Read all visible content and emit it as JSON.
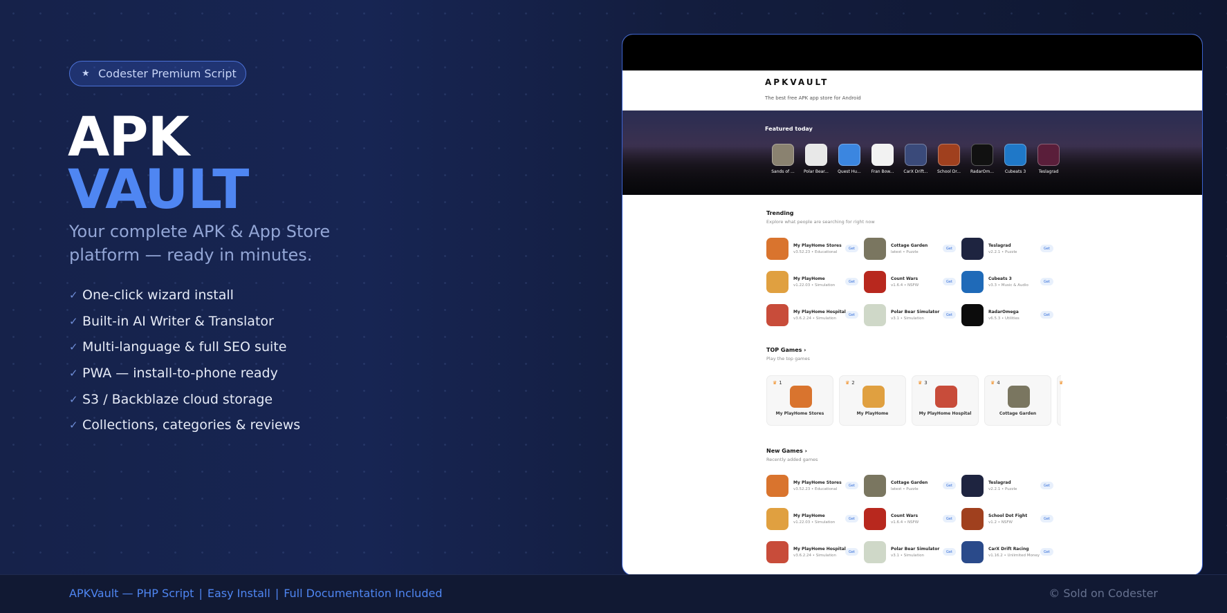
{
  "badge": {
    "icon": "star-icon",
    "label": "Codester Premium Script"
  },
  "title": {
    "line1": "APK",
    "line2": "VAULT"
  },
  "subtitle": "Your complete APK & App Store platform — ready in minutes.",
  "features": [
    {
      "icon": "check-icon",
      "label": "One-click wizard install"
    },
    {
      "icon": "check-icon",
      "label": "Built-in AI Writer & Translator"
    },
    {
      "icon": "check-icon",
      "label": "Multi-language & full SEO suite"
    },
    {
      "icon": "check-icon",
      "label": "PWA — install-to-phone ready"
    },
    {
      "icon": "check-icon",
      "label": "S3 / Backblaze cloud storage"
    },
    {
      "icon": "check-icon",
      "label": "Collections, categories & reviews"
    }
  ],
  "footer": {
    "left": [
      "APKVault — PHP Script",
      "Easy Install",
      "Full Documentation Included"
    ],
    "separator": "|",
    "right": "© Sold on Codester"
  },
  "colors": {
    "accent": "#4f86f2",
    "background": "#131c38"
  },
  "preview": {
    "brand": "APKVAULT",
    "tagline": "The best free APK app store for Android",
    "featured": {
      "title": "Featured today",
      "apps": [
        {
          "label": "Sands of ...",
          "color": "#8a8270"
        },
        {
          "label": "Polar Bear...",
          "color": "#e8e8e8"
        },
        {
          "label": "Quest Hu...",
          "color": "#3b86e0"
        },
        {
          "label": "Fran Bow...",
          "color": "#f2f2f2"
        },
        {
          "label": "CarX Drift...",
          "color": "#3a4a7a"
        },
        {
          "label": "School Dr...",
          "color": "#a0401e"
        },
        {
          "label": "RadarOm...",
          "color": "#111111"
        },
        {
          "label": "Cubeats 3",
          "color": "#1f78c8"
        },
        {
          "label": "Teslagrad",
          "color": "#5a1e3a"
        }
      ]
    },
    "trending": {
      "title": "Trending",
      "subtitle": "Explore what people are searching for right now",
      "get_label": "Get",
      "apps": [
        {
          "name": "My PlayHome Stores",
          "sub": "v3.52.23 • Educational",
          "color": "#d9742e"
        },
        {
          "name": "Cottage Garden",
          "sub": "latest • Puzzle",
          "color": "#7a7660"
        },
        {
          "name": "Teslagrad",
          "sub": "v2.2.1 • Puzzle",
          "color": "#1e2440"
        },
        {
          "name": "My PlayHome",
          "sub": "v1.22.03 • Simulation",
          "color": "#e0a040"
        },
        {
          "name": "Count Wars",
          "sub": "v1.6.4 • NSFW",
          "color": "#b8281e"
        },
        {
          "name": "Cubeats 3",
          "sub": "v3.3 • Music & Audio",
          "color": "#1f6ab8"
        },
        {
          "name": "My PlayHome Hospital",
          "sub": "v3.6.2.24 • Simulation",
          "color": "#c84c3a"
        },
        {
          "name": "Polar Bear Simulator",
          "sub": "v3.1 • Simulation",
          "color": "#cfd8c8"
        },
        {
          "name": "RadarOmega",
          "sub": "v6.5.3 • Utilities",
          "color": "#0c0c0c"
        }
      ]
    },
    "top_games": {
      "title": "TOP Games ›",
      "subtitle": "Play the top games",
      "apps": [
        {
          "rank": "1",
          "name": "My PlayHome Stores",
          "color": "#d9742e"
        },
        {
          "rank": "2",
          "name": "My PlayHome",
          "color": "#e0a040"
        },
        {
          "rank": "3",
          "name": "My PlayHome Hospital",
          "color": "#c84c3a"
        },
        {
          "rank": "4",
          "name": "Cottage Garden",
          "color": "#7a7660"
        }
      ]
    },
    "new_games": {
      "title": "New Games ›",
      "subtitle": "Recently added games",
      "apps": [
        {
          "name": "My PlayHome Stores",
          "sub": "v3.52.23 • Educational",
          "color": "#d9742e"
        },
        {
          "name": "Cottage Garden",
          "sub": "latest • Puzzle",
          "color": "#7a7660"
        },
        {
          "name": "Teslagrad",
          "sub": "v2.2.1 • Puzzle",
          "color": "#1e2440"
        },
        {
          "name": "My PlayHome",
          "sub": "v1.22.03 • Simulation",
          "color": "#e0a040"
        },
        {
          "name": "Count Wars",
          "sub": "v1.6.4 • NSFW",
          "color": "#b8281e"
        },
        {
          "name": "School Dot Fight",
          "sub": "v1.2 • NSFW",
          "color": "#a0401e"
        },
        {
          "name": "My PlayHome Hospital",
          "sub": "v3.6.2.24 • Simulation",
          "color": "#c84c3a"
        },
        {
          "name": "Polar Bear Simulator",
          "sub": "v3.1 • Simulation",
          "color": "#cfd8c8"
        },
        {
          "name": "CarX Drift Racing",
          "sub": "v1.16.2 • Unlimited Money",
          "color": "#2a4a8a"
        }
      ]
    }
  }
}
